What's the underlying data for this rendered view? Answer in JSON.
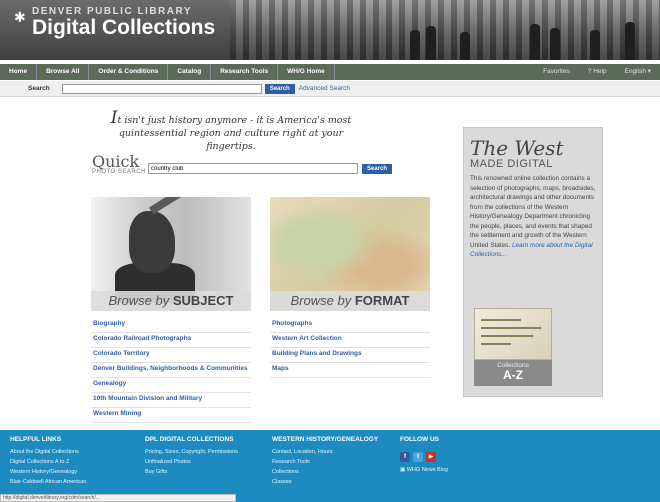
{
  "brand": {
    "top": "DENVER PUBLIC LIBRARY",
    "main": "Digital Collections"
  },
  "nav": {
    "items": [
      "Home",
      "Browse All",
      "Order & Conditions",
      "Catalog",
      "Research Tools",
      "WH/G Home"
    ],
    "right": [
      "Favorites",
      "? Help",
      "English ▾"
    ]
  },
  "search": {
    "label": "Search",
    "value": "",
    "button": "Search",
    "advanced": "Advanced Search"
  },
  "tagline": {
    "lead": "I",
    "rest": "t isn't just history anymore - ",
    "emph": "it is America's most quintessential region and culture right at your fingertips."
  },
  "quick": {
    "title": "Quick",
    "sub": "PHOTO SEARCH",
    "value": "country club",
    "button": "Search"
  },
  "browse_subject": {
    "caption_pre": "Browse by ",
    "caption_bold": "SUBJECT",
    "links": [
      "Biography",
      "Colorado Railroad Photographs",
      "Colorado Territory",
      "Denver Buildings, Neighborhoods & Communities",
      "Genealogy",
      "10th Mountain Division and Military",
      "Western Mining"
    ]
  },
  "browse_format": {
    "caption_pre": "Browse by ",
    "caption_bold": "FORMAT",
    "links": [
      "Photographs",
      "Western Art Collection",
      "Building Plans and Drawings",
      "Maps"
    ]
  },
  "sidebar": {
    "title_a": "The ",
    "title_b": "West",
    "subtitle": "MADE DIGITAL",
    "body": "This renowned online collection contains a selection of photographs, maps, broadsides, architectural drawings and other documents from the collections of the Western History/Genealogy Department chronicling the people, places, and events that shaped the settlement and growth of the Western United States.",
    "more": "Learn more about the Digital Collections...",
    "az_small": "Collections",
    "az_big": "A-Z"
  },
  "footer": {
    "helpful": {
      "title": "HELPFUL LINKS",
      "links": [
        "About the Digital Collections",
        "Digital Collections A to Z",
        "Western History/Genealogy",
        "Blair-Caldwell African American"
      ]
    },
    "dpl": {
      "title": "DPL DIGITAL COLLECTIONS",
      "links": [
        "Pricing, Sizes, Copyright, Permissions",
        "Unfinalized Photos",
        "Buy Gifts"
      ]
    },
    "western": {
      "title": "WESTERN HISTORY/GENEALOGY",
      "links": [
        "Contact, Location, Hours",
        "Research Tools",
        "Collections",
        "Classes"
      ]
    },
    "follow": {
      "title": "FOLLOW US",
      "news": "WHG News Blog"
    }
  },
  "status": "http://digital.denverlibrary.org/cdm/search/..."
}
